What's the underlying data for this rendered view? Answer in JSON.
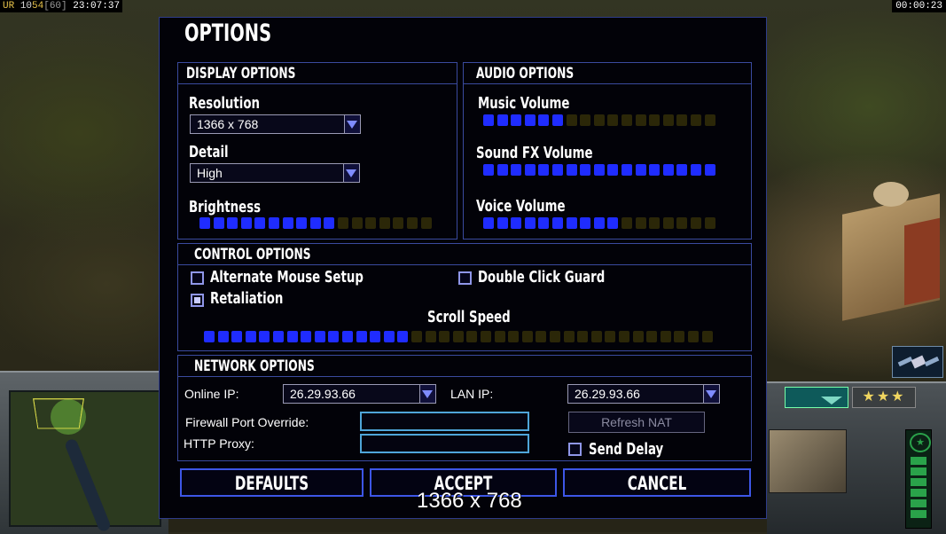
{
  "status_bar": {
    "code": "UR",
    "count": "10",
    "fps": "54",
    "fps_cap": "[60]",
    "clock": "23:07:37",
    "game_time": "00:00:23"
  },
  "hud": {
    "rank_stars": "★★★",
    "power_emblem": "★"
  },
  "options": {
    "title": "OPTIONS",
    "display": {
      "heading": "DISPLAY OPTIONS",
      "resolution_label": "Resolution",
      "resolution_value": "1366 x 768",
      "detail_label": "Detail",
      "detail_value": "High",
      "brightness_label": "Brightness",
      "brightness_level": 0.6
    },
    "audio": {
      "heading": "AUDIO OPTIONS",
      "music_label": "Music Volume",
      "music_level": 0.35,
      "sfx_label": "Sound FX Volume",
      "sfx_level": 1.0,
      "voice_label": "Voice Volume",
      "voice_level": 0.6
    },
    "control": {
      "heading": "CONTROL OPTIONS",
      "alt_mouse_label": "Alternate Mouse Setup",
      "alt_mouse_checked": false,
      "double_click_label": "Double Click Guard",
      "double_click_checked": false,
      "retaliation_label": "Retaliation",
      "retaliation_checked": true,
      "scroll_label": "Scroll Speed",
      "scroll_level": 0.4
    },
    "network": {
      "heading": "NETWORK OPTIONS",
      "online_ip_label": "Online IP:",
      "online_ip_value": "26.29.93.66",
      "lan_ip_label": "LAN IP:",
      "lan_ip_value": "26.29.93.66",
      "firewall_label": "Firewall Port Override:",
      "firewall_value": "",
      "http_proxy_label": "HTTP Proxy:",
      "http_proxy_value": "",
      "refresh_nat_label": "Refresh NAT",
      "send_delay_label": "Send Delay",
      "send_delay_checked": false
    },
    "buttons": {
      "defaults": "DEFAULTS",
      "accept": "ACCEPT",
      "cancel": "CANCEL"
    },
    "tooltip": "1366 x 768"
  },
  "colors": {
    "segment_on": "#1f2cff",
    "segment_off": "#2b2708",
    "panel_border": "#3a4a9e",
    "button_border": "#3d56e6"
  }
}
